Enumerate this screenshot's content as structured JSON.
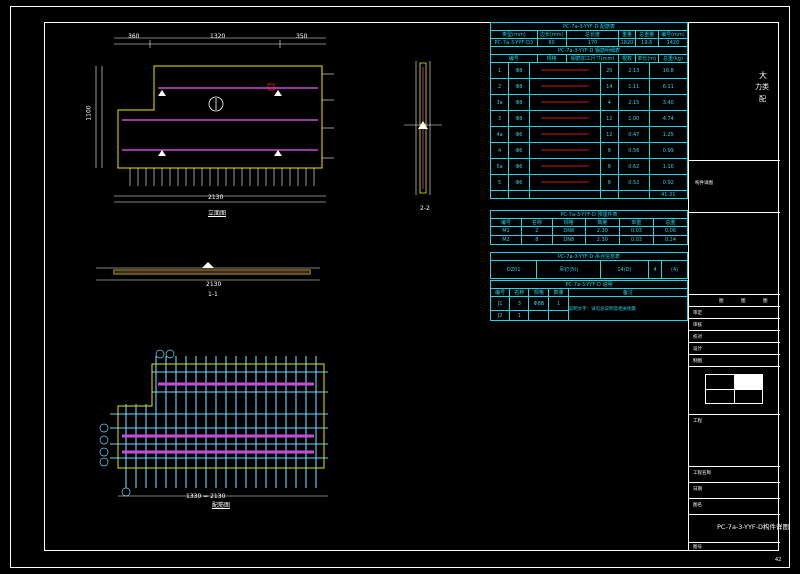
{
  "drawing": {
    "plan_label": "立面图",
    "section_1_1_label": "1-1",
    "section_2_2_label": "2-2",
    "rebar_plan_label": "配筋图",
    "plan_dim_total": "2130",
    "plan_dim_parts": [
      "360",
      "1320",
      "350"
    ],
    "plan_height_dim": "1100",
    "section_dim": "2130",
    "rebar_dim": "1330 = 2130"
  },
  "tables": {
    "rebar_table_title": "PC-7a-3-YYF-D 配筋表",
    "rebar_header": [
      "类型(mm)",
      "边长(mm)",
      "总长度",
      "重量",
      "总重量",
      "编号(mm)"
    ],
    "rebar_summary_row": [
      "PC-7a-3-YYF-D3",
      "60",
      "170",
      "1820",
      "19.6",
      "1420"
    ],
    "rebar_detail_title": "PC-7a-3-YYF-D 钢筋明细表",
    "rebar_detail_header": [
      "编号",
      "规格",
      "钢筋加工尺寸(mm)",
      "根数",
      "单长(m)",
      "总重(kg)"
    ],
    "rebar_rows": [
      {
        "no": "1",
        "spec": "Φ8",
        "n": "20",
        "len": "2.13",
        "w": "16.8"
      },
      {
        "no": "2",
        "spec": "Φ8",
        "n": "14",
        "len": "1.11",
        "w": "6.11"
      },
      {
        "no": "3a",
        "spec": "Φ8",
        "n": "4",
        "len": "2.15",
        "w": "3.40"
      },
      {
        "no": "3",
        "spec": "Φ8",
        "n": "12",
        "len": "1.00",
        "w": "4.74"
      },
      {
        "no": "4a",
        "spec": "Φ6",
        "n": "12",
        "len": "0.47",
        "w": "1.25"
      },
      {
        "no": "4",
        "spec": "Φ6",
        "n": "8",
        "len": "0.56",
        "w": "0.99"
      },
      {
        "no": "5a",
        "spec": "Φ6",
        "n": "8",
        "len": "0.62",
        "w": "1.10"
      },
      {
        "no": "5",
        "spec": "Φ6",
        "n": "8",
        "len": "0.52",
        "w": "0.92"
      }
    ],
    "rebar_total": "41.31",
    "embed_title": "PC-7a-3-YYF-D 预埋件表",
    "embed_header": [
      "编号",
      "名称",
      "规格",
      "数量",
      "单重",
      "总重"
    ],
    "embed_rows": [
      [
        "M1",
        "2",
        "DN8",
        "2.30",
        "0.03",
        "0.06"
      ],
      [
        "M2",
        "8",
        "DN8",
        "2.30",
        "0.03",
        "0.24"
      ]
    ],
    "lift_title": "PC-7a-3-YYF-D 吊点信息表",
    "lift_row": [
      "DZ01",
      "吊钉(5t)",
      "14(D)",
      "4",
      "(4)"
    ],
    "note_title": "PC-7a-3-YYF-D 说明",
    "note_header": [
      "编号",
      "名称",
      "规格",
      "数量",
      "备注"
    ],
    "note_rows": [
      [
        "J1",
        "3",
        "Φ8B",
        "1",
        "1"
      ],
      [
        "J2",
        "1",
        "",
        "",
        ""
      ]
    ],
    "note_text": "说明文字：详见总说明及相关图集"
  },
  "title_block": {
    "side_text_1": "大",
    "side_text_2": "力类",
    "side_text_3": "配",
    "side_note": "构件详图",
    "fields": [
      "审定",
      "审核",
      "校对",
      "设计",
      "制图",
      "工程",
      "日期"
    ],
    "header_cells": [
      "图",
      "图",
      "图"
    ],
    "project_label": "工程名称",
    "sheet_label": "图名",
    "drawing_name": "PC-7a-3-YYF-D构件详图",
    "sheet_no_label": "图号",
    "page": "42"
  },
  "colors": {
    "background": "#000000",
    "line": "#ffffff",
    "cyan": "#29d3e6",
    "yellow": "#f2e600",
    "magenta": "#c84bd8",
    "red": "#ff2020",
    "green": "#20e020"
  }
}
